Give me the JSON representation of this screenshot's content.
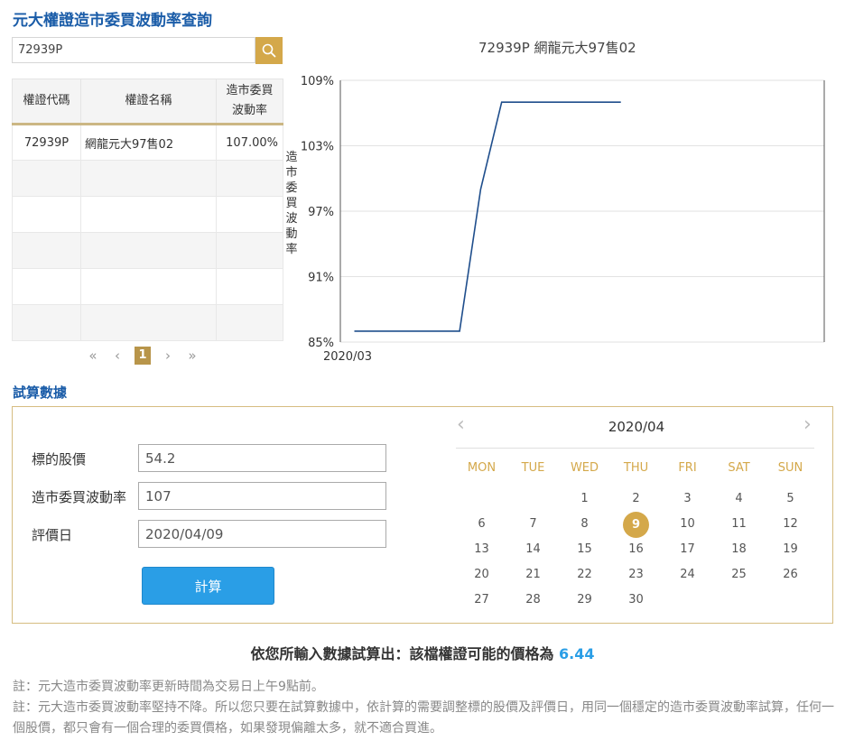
{
  "page_title": "元大權證造市委買波動率查詢",
  "search": {
    "value": "72939P"
  },
  "table": {
    "headers": [
      "權證代碼",
      "權證名稱",
      "造市委買\n波動率"
    ],
    "rows": [
      {
        "code": "72939P",
        "name": "網龍元大97售02",
        "vol": "107.00%"
      }
    ]
  },
  "pagination": {
    "first": "«",
    "prev": "‹",
    "current": "1",
    "next": "›",
    "last": "»"
  },
  "chart": {
    "title": "72939P 網龍元大97售02",
    "ylabel": "造市委買波動率"
  },
  "chart_data": {
    "type": "line",
    "title": "72939P 網龍元大97售02",
    "xlabel": "",
    "ylabel": "造市委買波動率",
    "x_tick_labels": [
      "2020/03"
    ],
    "y_tick_labels": [
      "109%",
      "103%",
      "97%",
      "91%",
      "85%"
    ],
    "ylim": [
      85,
      109
    ],
    "grid": true,
    "series": [
      {
        "color": "#1f4e8c",
        "x": [
          "2020/03/02",
          "2020/03/17",
          "2020/03/20",
          "2020/03/23",
          "2020/04/09"
        ],
        "y": [
          86,
          86,
          99,
          107,
          107
        ]
      }
    ]
  },
  "calc": {
    "section_title": "試算數據",
    "fields": [
      {
        "label": "標的股價",
        "value": "54.2"
      },
      {
        "label": "造市委買波動率",
        "value": "107"
      },
      {
        "label": "評價日",
        "value": "2020/04/09"
      }
    ],
    "button_label": "計算"
  },
  "calendar": {
    "title": "2020/04",
    "prev_icon": "‹",
    "next_icon": "›",
    "weekdays": [
      "MON",
      "TUE",
      "WED",
      "THU",
      "FRI",
      "SAT",
      "SUN"
    ],
    "first_weekday": 2,
    "days": [
      "1",
      "2",
      "3",
      "4",
      "5",
      "6",
      "7",
      "8",
      "9",
      "10",
      "11",
      "12",
      "13",
      "14",
      "15",
      "16",
      "17",
      "18",
      "19",
      "20",
      "21",
      "22",
      "23",
      "24",
      "25",
      "26",
      "27",
      "28",
      "29",
      "30"
    ],
    "selected": "9",
    "accent": "#d4a84a"
  },
  "result": {
    "text": "依您所輸入數據試算出：該檔權證可能的價格為",
    "value": "6.44"
  },
  "notes": [
    "註：元大造市委買波動率更新時間為交易日上午9點前。",
    "註：元大造市委買波動率堅持不降。所以您只要在試算數據中，依計算的需要調整標的股價及評價日，用同一個穩定的造市委買波動率試算，任何一個股價，都只會有一個合理的委買價格，如果發現偏離太多，就不適合買進。"
  ]
}
